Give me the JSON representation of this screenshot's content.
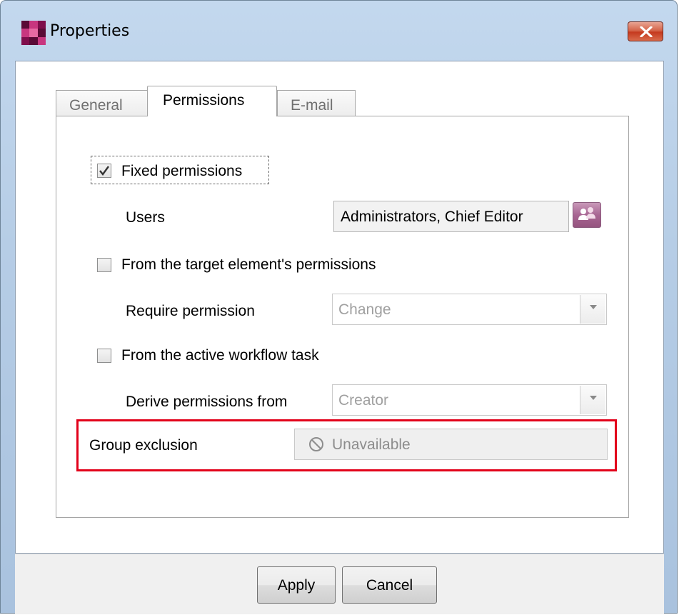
{
  "window": {
    "title": "Properties"
  },
  "tabs": [
    {
      "label": "General",
      "active": false
    },
    {
      "label": "Permissions",
      "active": true
    },
    {
      "label": "E-mail",
      "active": false
    }
  ],
  "permissions": {
    "fixed_permissions": {
      "label": "Fixed permissions",
      "checked": true
    },
    "users": {
      "label": "Users",
      "value": "Administrators, Chief Editor"
    },
    "from_target_element": {
      "label": "From the target element's permissions",
      "checked": false
    },
    "require_permission": {
      "label": "Require permission",
      "value": "Change"
    },
    "from_workflow_task": {
      "label": "From the active workflow task",
      "checked": false
    },
    "derive_permissions": {
      "label": "Derive permissions from",
      "value": "Creator"
    },
    "group_exclusion": {
      "label": "Group exclusion",
      "value": "Unavailable"
    }
  },
  "footer": {
    "apply_label": "Apply",
    "cancel_label": "Cancel"
  },
  "colors": {
    "highlight": "#e2001a",
    "brand": "#a0115f",
    "users_button": "#a86593"
  },
  "icons": {
    "app": "app-logo-icon",
    "close": "close-icon",
    "users": "users-icon",
    "dropdown": "chevron-down-icon",
    "unavailable": "prohibited-icon"
  }
}
